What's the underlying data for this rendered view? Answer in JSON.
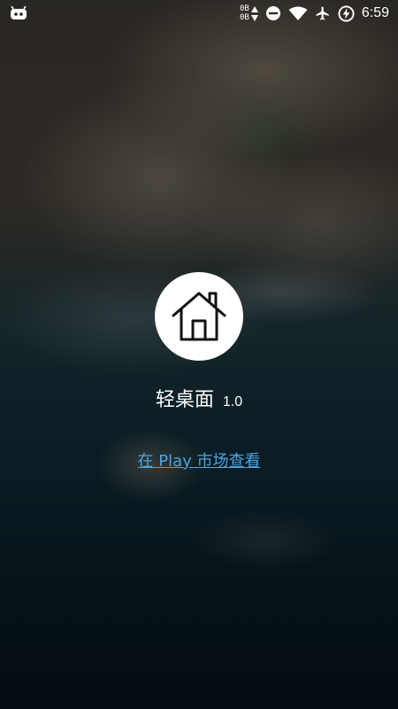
{
  "status_bar": {
    "notification_icon": "android-robot-icon",
    "upload_rate": "0B",
    "download_rate": "0B",
    "icons": [
      "do-not-disturb-icon",
      "wifi-icon",
      "airplane-icon",
      "battery-charging-icon"
    ],
    "time": "6:59"
  },
  "app": {
    "icon": "home-icon",
    "name": "轻桌面",
    "version": "1.0",
    "store_link": "在 Play 市场查看"
  },
  "colors": {
    "link": "#4aa3e0",
    "icon_bg": "#ffffff"
  }
}
